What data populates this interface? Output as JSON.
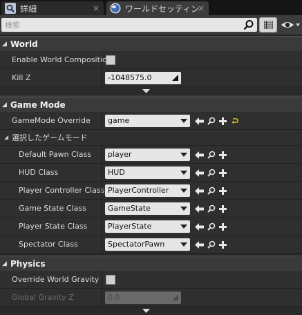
{
  "tabs": [
    {
      "label": "詳細",
      "icon": "search-icon",
      "close": "×"
    },
    {
      "label": "ワールドセッティン",
      "icon": "globe-icon",
      "close": "×"
    }
  ],
  "search": {
    "placeholder": "検索",
    "value": ""
  },
  "sections": {
    "world": {
      "title": "World",
      "enable_composition_label": "Enable World Composition",
      "enable_composition_checked": false,
      "kill_z_label": "Kill Z",
      "kill_z_value": "-1048575.0"
    },
    "game_mode": {
      "title": "Game Mode",
      "override_label": "GameMode Override",
      "override_value": "game",
      "selected_label": "選択したゲームモード",
      "classes": [
        {
          "label": "Default Pawn Class",
          "value": "player"
        },
        {
          "label": "HUD Class",
          "value": "HUD"
        },
        {
          "label": "Player Controller Class",
          "value": "PlayerController"
        },
        {
          "label": "Game State Class",
          "value": "GameState"
        },
        {
          "label": "Player State Class",
          "value": "PlayerState"
        },
        {
          "label": "Spectator Class",
          "value": "SpectatorPawn"
        }
      ]
    },
    "physics": {
      "title": "Physics",
      "override_gravity_label": "Override World Gravity",
      "override_gravity_checked": false,
      "global_gravity_label": "Global Gravity Z",
      "global_gravity_value": "0.0"
    }
  },
  "colors": {
    "background": "#242424",
    "row": "#2f2f2f",
    "header": "#3a3a3a",
    "field": "#e6e6e6",
    "accent_yellow": "#d4c21a"
  }
}
